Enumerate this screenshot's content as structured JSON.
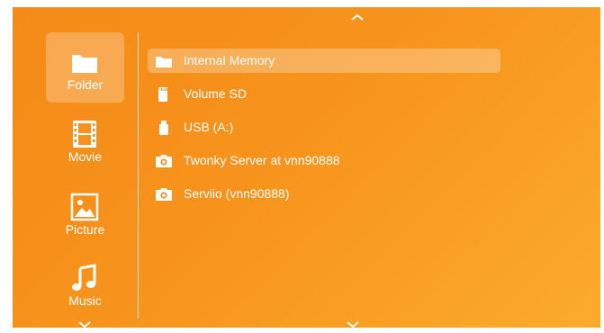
{
  "sidebar": {
    "items": [
      {
        "label": "Folder",
        "icon": "folder-icon",
        "selected": true
      },
      {
        "label": "Movie",
        "icon": "film-icon",
        "selected": false
      },
      {
        "label": "Picture",
        "icon": "picture-icon",
        "selected": false
      },
      {
        "label": "Music",
        "icon": "music-note-icon",
        "selected": false
      }
    ]
  },
  "sources": {
    "items": [
      {
        "label": "Internal Memory",
        "icon": "folder-icon",
        "selected": true
      },
      {
        "label": "Volume SD",
        "icon": "sd-card-icon",
        "selected": false
      },
      {
        "label": "USB (A:)",
        "icon": "usb-drive-icon",
        "selected": false
      },
      {
        "label": "Twonky Server at vnn90888",
        "icon": "media-server-icon",
        "selected": false
      },
      {
        "label": "Serviio (vnn90888)",
        "icon": "media-server-icon",
        "selected": false
      }
    ]
  },
  "colors": {
    "background_start": "#f58a17",
    "background_end": "#fbab2c",
    "text": "#ffffff"
  }
}
